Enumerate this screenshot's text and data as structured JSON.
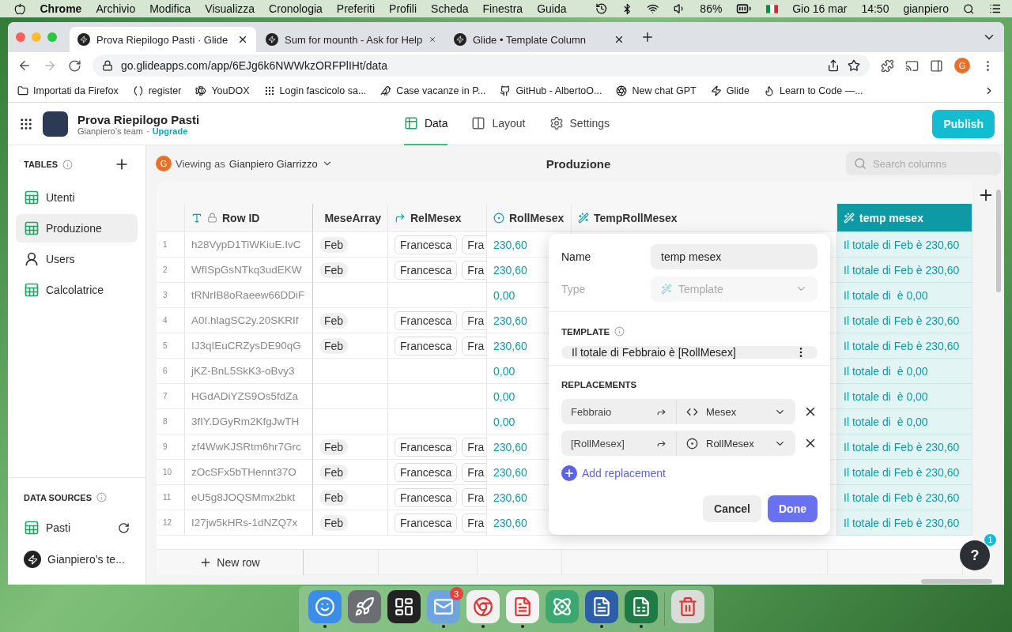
{
  "menu_bar": {
    "app": "Chrome",
    "menus": [
      "Archivio",
      "Modifica",
      "Visualizza",
      "Cronologia",
      "Preferiti",
      "Profili",
      "Scheda",
      "Finestra",
      "Guida"
    ],
    "battery": "86%",
    "date": "Gio 16 mar",
    "time": "14:50",
    "user": "gianpiero"
  },
  "browser": {
    "tabs": [
      {
        "title": "Prova Riepilogo Pasti · Glide",
        "selected": true
      },
      {
        "title": "Sum for mounth - Ask for Help",
        "selected": false
      },
      {
        "title": "Glide • Template Column",
        "selected": false
      }
    ],
    "url": "go.glideapps.com/app/6EJg6k6NWWkzORFPlIHt/data",
    "profile": "G",
    "bookmarks": [
      {
        "label": "Importati da Firefox",
        "kind": "folder"
      },
      {
        "label": "register",
        "kind": "parentheses"
      },
      {
        "label": "YouDOX",
        "kind": "fish"
      },
      {
        "label": "Login fascicolo sa...",
        "kind": "dots"
      },
      {
        "label": "Case vacanze in P...",
        "kind": "bird"
      },
      {
        "label": "GitHub - AlbertoO...",
        "kind": "github"
      },
      {
        "label": "New chat GPT",
        "kind": "aperture"
      },
      {
        "label": "Glide",
        "kind": "bolt"
      },
      {
        "label": "Learn to Code —...",
        "kind": "flame"
      }
    ]
  },
  "app": {
    "title": "Prova Riepilogo Pasti",
    "team": "Gianpiero’s team",
    "separator": "·",
    "upgrade": "Upgrade",
    "nav": [
      {
        "label": "Data",
        "kind": "data",
        "selected": true
      },
      {
        "label": "Layout",
        "kind": "layout",
        "selected": false
      },
      {
        "label": "Settings",
        "kind": "settings",
        "selected": false
      }
    ],
    "publish": "Publish"
  },
  "sidebar": {
    "tables_heading": "TABLES",
    "tables": [
      {
        "name": "Utenti",
        "kind": "sheet",
        "selected": false
      },
      {
        "name": "Produzione",
        "kind": "sheet",
        "selected": true
      },
      {
        "name": "Users",
        "kind": "users",
        "selected": false
      },
      {
        "name": "Calcolatrice",
        "kind": "sheet",
        "selected": false
      }
    ],
    "sources_heading": "DATA SOURCES",
    "sources": [
      {
        "name": "Pasti",
        "kind": "sheet"
      },
      {
        "name": "Gianpiero’s te...",
        "kind": "glide"
      }
    ]
  },
  "toolbar": {
    "avatar": "G",
    "viewing_as": "Viewing as",
    "user": "Gianpiero Giarrizzo",
    "title": "Produzione",
    "search_placeholder": "Search columns"
  },
  "table": {
    "columns": [
      {
        "label": "Row ID",
        "kind": "rowid",
        "selected": false
      },
      {
        "label": "MeseArray",
        "kind": "array",
        "selected": false
      },
      {
        "label": "RelMesex",
        "kind": "relation",
        "selected": false
      },
      {
        "label": "RollMesex",
        "kind": "rollup",
        "selected": false
      },
      {
        "label": "TempRollMesex",
        "kind": "template",
        "selected": false
      },
      {
        "label": "temp mesex",
        "kind": "template",
        "selected": true
      }
    ],
    "rows": [
      {
        "n": "1",
        "id": "h28VypD1TiWKiuE.IvC",
        "mese": "Feb",
        "rel": [
          "Francesca",
          "Fra"
        ],
        "roll": "230,60",
        "temp": "Il totale di Feb è 230,60"
      },
      {
        "n": "2",
        "id": "WfISpGsNTkq3udEKW",
        "mese": "Feb",
        "rel": [
          "Francesca",
          "Fra"
        ],
        "roll": "230,60",
        "temp": "Il totale di Feb è 230,60"
      },
      {
        "n": "3",
        "id": "tRNrIB8oRaeew66DDiF",
        "roll": "0,00",
        "temp": "Il totale di  è 0,00"
      },
      {
        "n": "4",
        "id": "A0I.hlagSC2y.20SKRIf",
        "mese": "Feb",
        "rel": [
          "Francesca",
          "Fra"
        ],
        "roll": "230,60",
        "temp": "Il totale di Feb è 230,60"
      },
      {
        "n": "5",
        "id": "IJ3qIEuCRZysDE90qG",
        "mese": "Feb",
        "rel": [
          "Francesca",
          "Fra"
        ],
        "roll": "230,60",
        "temp": "Il totale di Feb è 230,60"
      },
      {
        "n": "6",
        "id": "jKZ-BnL5SkK3-oBvy3",
        "roll": "0,00",
        "temp": "Il totale di  è 0,00"
      },
      {
        "n": "7",
        "id": "HGdADiYZS9Os5fdZa",
        "roll": "0,00",
        "temp": "Il totale di  è 0,00"
      },
      {
        "n": "8",
        "id": "3fIY.DGyRm2KfgJwTH",
        "roll": "0,00",
        "temp": "Il totale di  è 0,00"
      },
      {
        "n": "9",
        "id": "zf4WwKJSRtm6hr7Grc",
        "mese": "Feb",
        "rel": [
          "Francesca",
          "Fra"
        ],
        "roll": "230,60",
        "temp": "Il totale di Feb è 230,60"
      },
      {
        "n": "10",
        "id": "zOcSFx5bTHennt37O",
        "mese": "Feb",
        "rel": [
          "Francesca",
          "Fra"
        ],
        "roll": "230,60",
        "temp": "Il totale di Feb è 230,60"
      },
      {
        "n": "11",
        "id": "eU5g8JOQSMmx2bkt",
        "mese": "Feb",
        "rel": [
          "Francesca",
          "Fra"
        ],
        "roll": "230,60",
        "temp": "Il totale di Feb è 230,60"
      },
      {
        "n": "12",
        "id": "I27jw5kHRs-1dNZQ7x",
        "mese": "Feb",
        "rel": [
          "Francesca",
          "Fra"
        ],
        "roll": "230,60",
        "temp": "Il totale di Feb è 230,60"
      }
    ],
    "new_row": "New row"
  },
  "editor": {
    "name_label": "Name",
    "name_value": "temp mesex",
    "type_label": "Type",
    "type_value": "Template",
    "type_disabled": true,
    "template_heading": "TEMPLATE",
    "template": "Il totale di Febbraio è [RollMesex]",
    "replacements_heading": "REPLACEMENTS",
    "replacements": [
      {
        "from": "Febbraio",
        "to": "Mesex",
        "kind": "code"
      },
      {
        "from": "[RollMesex]",
        "to": "RollMesex",
        "kind": "rollup"
      }
    ],
    "add": "Add replacement",
    "cancel": "Cancel",
    "done": "Done"
  },
  "help": {
    "label": "?",
    "badge": "1"
  },
  "dock": [
    {
      "kind": "finder",
      "running": true
    },
    {
      "kind": "launchpad",
      "running": false
    },
    {
      "kind": "mission",
      "running": false
    },
    {
      "kind": "mail",
      "running": true,
      "badge": "3"
    },
    {
      "kind": "chrome",
      "running": true
    },
    {
      "kind": "acrobat",
      "running": true
    },
    {
      "kind": "atom",
      "running": false
    },
    {
      "kind": "word",
      "running": true
    },
    {
      "kind": "excel",
      "running": true
    },
    {
      "kind": "trash",
      "running": false
    }
  ]
}
